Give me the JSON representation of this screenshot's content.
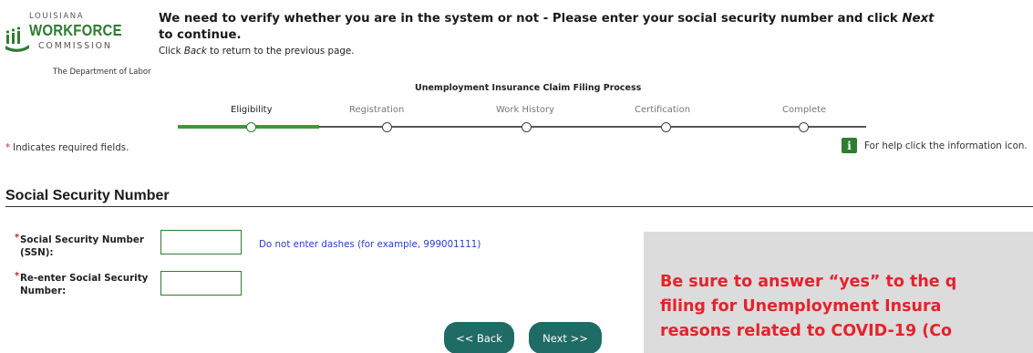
{
  "logo": {
    "state": "LOUISIANA",
    "name": "WORKFORCE",
    "sub": "COMMISSION",
    "dept": "The Department of Labor"
  },
  "header": {
    "title_before": "We need to verify whether you are in the system or not - Please enter your social security number and click ",
    "title_italic": "Next",
    "title_after": " to continue.",
    "sub_before": "Click ",
    "sub_italic": "Back",
    "sub_after": " to return to the previous page."
  },
  "progress": {
    "title": "Unemployment Insurance Claim Filing Process",
    "steps": [
      "Eligibility",
      "Registration",
      "Work History",
      "Certification",
      "Complete"
    ],
    "active_step": "Eligibility"
  },
  "required_note": "Indicates required fields.",
  "required_star": "*",
  "help": {
    "icon": "info-icon",
    "icon_glyph": "i",
    "text": "For help click the information icon."
  },
  "section": {
    "title": "Social Security Number"
  },
  "fields": {
    "ssn_label": "Social Security Number (SSN):",
    "ssn_value": "",
    "ssn_hint": "Do not enter dashes (for example, 999001111)",
    "confirm_label": "Re-enter Social Security Number:",
    "confirm_value": ""
  },
  "buttons": {
    "back": "<< Back",
    "next": "Next >>"
  },
  "notice": {
    "line1": "Be sure to answer “yes” to the q",
    "line2": "filing for Unemployment Insura",
    "line3": "reasons related to COVID-19 (Co"
  },
  "colors": {
    "brand_green": "#2e7d32",
    "button_teal": "#1f6b66",
    "hint_blue": "#2a3fc9",
    "notice_red": "#e4232b",
    "notice_bg": "#dcdcdc"
  }
}
